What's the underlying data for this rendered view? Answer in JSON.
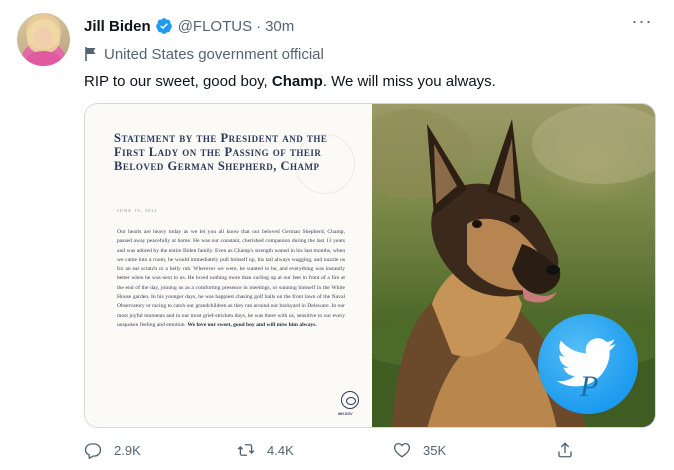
{
  "author": {
    "name": "Jill Biden",
    "handle": "@FLOTUS",
    "time": "30m",
    "label": "United States government official",
    "verified": true
  },
  "tweet": {
    "text_before": "RIP to our sweet, good boy, ",
    "text_bold": "Champ",
    "text_after": ". We will miss you always."
  },
  "media": {
    "statement_title": "Statement by the President and the First Lady on the Passing of their Beloved German Shepherd, Champ",
    "statement_date": "JUNE 19, 2021",
    "statement_body": "Our hearts are heavy today as we let you all know that our beloved German Shepherd, Champ, passed away peacefully at home. He was our constant, cherished companion during the last 13 years and was adored by the entire Biden family. Even as Champ's strength waned in his last months, when we came into a room, he would immediately pull himself up, his tail always wagging, and nuzzle us for an ear scratch or a belly rub. Wherever we were, he wanted to be, and everything was instantly better when he was next to us. He loved nothing more than curling up at our feet in front of a fire at the end of the day, joining us as a comforting presence in meetings, or sunning himself in the White House garden. In his younger days, he was happiest chasing golf balls on the front lawn of the Naval Observatory or racing to catch our grandchildren as they ran around our backyard in Delaware. In our most joyful moments and in our most grief-stricken days, he was there with us, sensitive to our every unspoken feeling and emotion.",
    "statement_closing": "We love our sweet, good boy and will miss him always.",
    "seal_label": "WH.GOV"
  },
  "actions": {
    "reply_count": "2.9K",
    "retweet_count": "4.4K",
    "like_count": "35K"
  },
  "colors": {
    "accent": "#1d9bf0",
    "secondary_text": "#536471",
    "statement_title": "#2b3a5c"
  },
  "icons": [
    "verified-badge-icon",
    "more-icon",
    "government-flag-icon",
    "reply-icon",
    "retweet-icon",
    "like-icon",
    "share-icon",
    "twitter-bird-icon"
  ]
}
